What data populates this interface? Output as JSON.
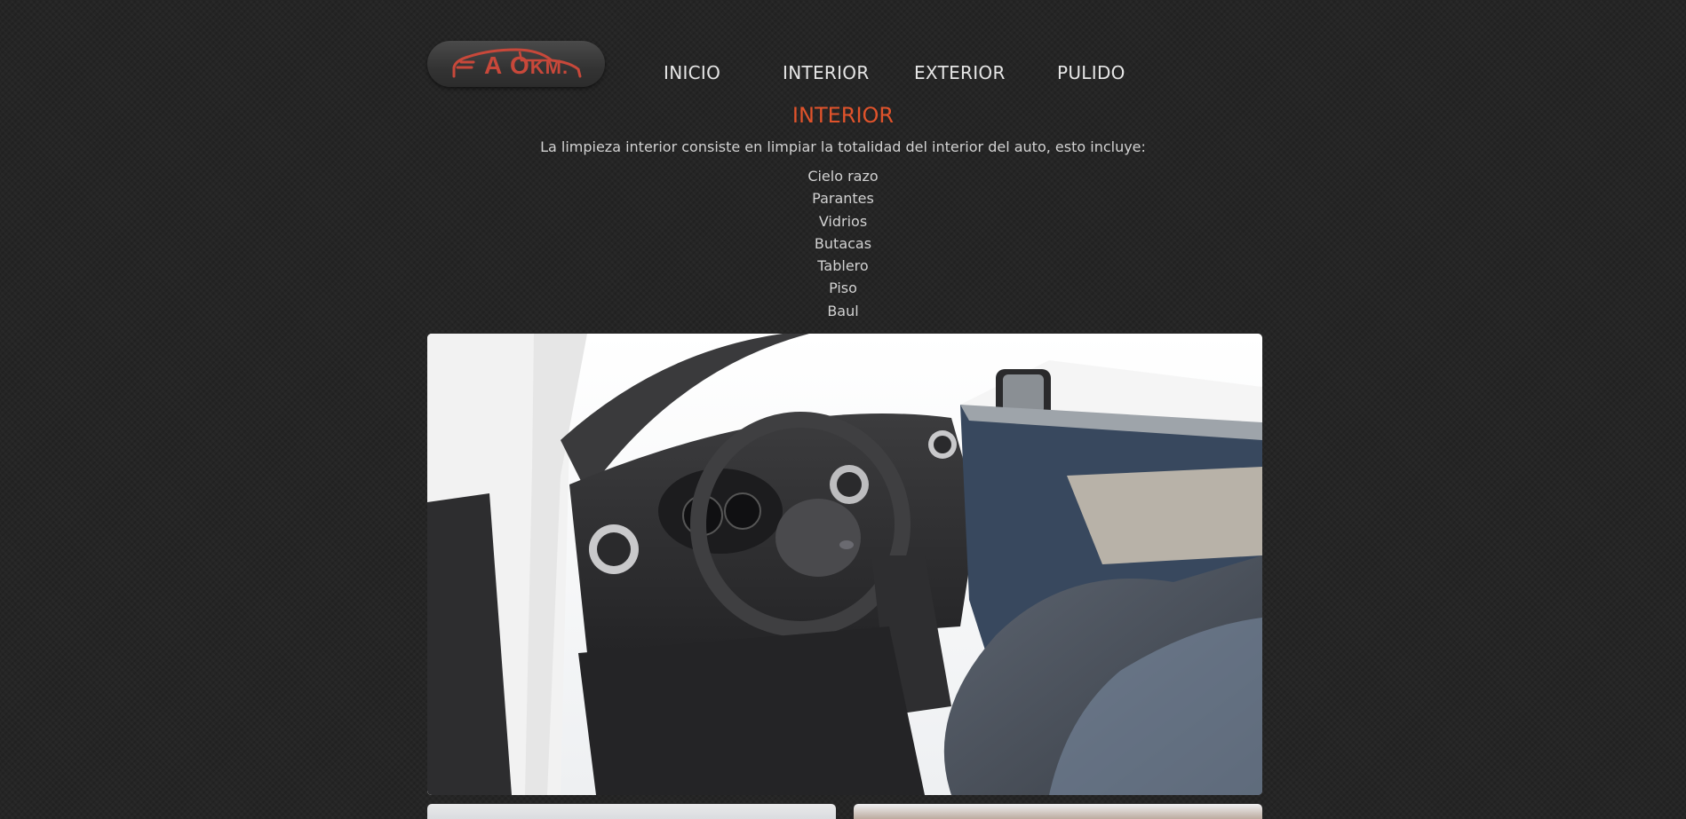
{
  "logo": {
    "text": "A 0KM.",
    "text_main": "A O",
    "text_small": "KM.",
    "brand_color": "#c8483a"
  },
  "nav": {
    "items": [
      {
        "label": "INICIO"
      },
      {
        "label": "INTERIOR"
      },
      {
        "label": "EXTERIOR"
      },
      {
        "label": "PULIDO"
      }
    ]
  },
  "page": {
    "title": "INTERIOR",
    "title_color": "#e0532b",
    "intro": "La limpieza interior consiste en limpiar la totalidad del interior del auto, esto incluye:",
    "items": [
      "Cielo razo",
      "Parantes",
      "Vidrios",
      "Butacas",
      "Tablero",
      "Piso",
      "Baul"
    ]
  },
  "photos": {
    "main": {
      "subject": "car-interior-photo"
    },
    "thumbs": [
      {
        "subject": "car-photo"
      },
      {
        "subject": "car-photo"
      }
    ]
  }
}
